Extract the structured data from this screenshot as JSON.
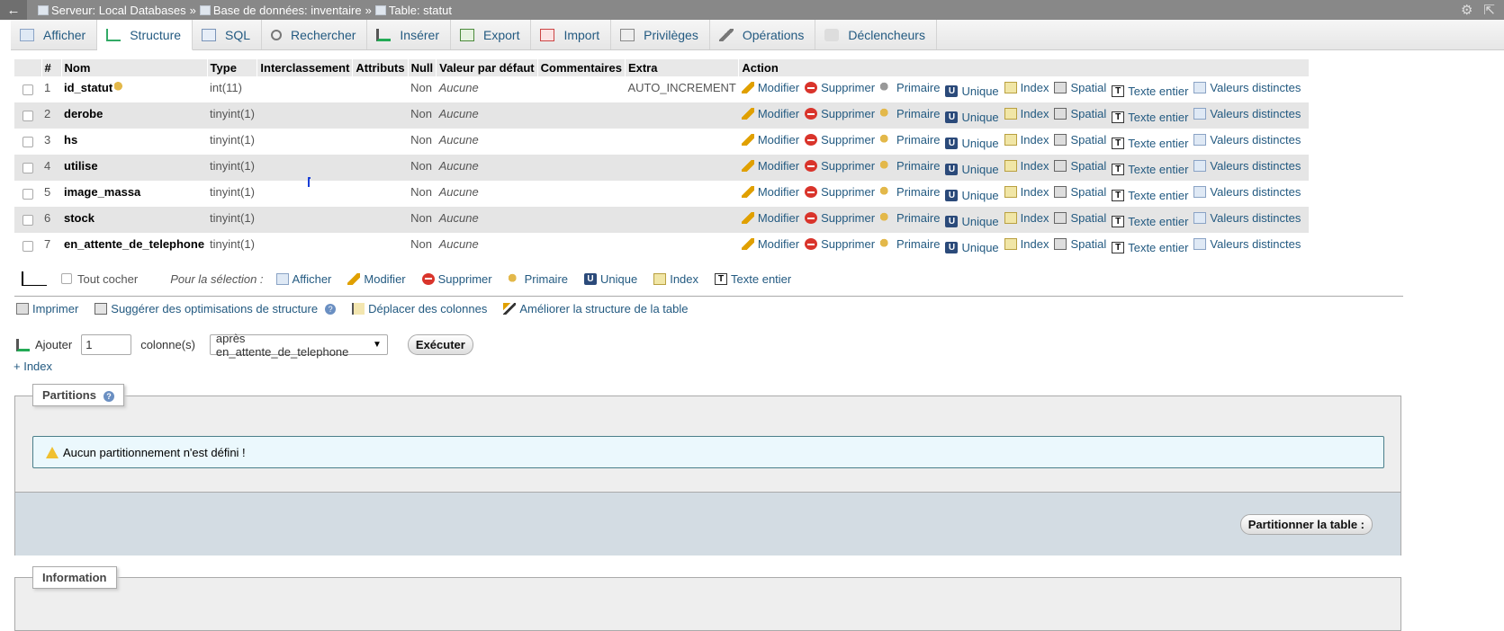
{
  "breadcrumb": {
    "back": "←",
    "server": "Serveur: Local Databases",
    "database": "Base de données: inventaire",
    "table": "Table: statut",
    "separator": "»"
  },
  "tabs": [
    {
      "label": "Afficher",
      "icon": "browse-icon"
    },
    {
      "label": "Structure",
      "icon": "structure-icon",
      "active": true
    },
    {
      "label": "SQL",
      "icon": "sql-icon"
    },
    {
      "label": "Rechercher",
      "icon": "search-icon"
    },
    {
      "label": "Insérer",
      "icon": "insert-icon"
    },
    {
      "label": "Export",
      "icon": "export-icon"
    },
    {
      "label": "Import",
      "icon": "import-icon"
    },
    {
      "label": "Privilèges",
      "icon": "privileges-icon"
    },
    {
      "label": "Opérations",
      "icon": "wrench-icon"
    },
    {
      "label": "Déclencheurs",
      "icon": "triggers-icon"
    }
  ],
  "table": {
    "headers": [
      "#",
      "Nom",
      "Type",
      "Interclassement",
      "Attributs",
      "Null",
      "Valeur par défaut",
      "Commentaires",
      "Extra",
      "Action"
    ],
    "actions": {
      "modifier": "Modifier",
      "supprimer": "Supprimer",
      "primaire": "Primaire",
      "unique": "Unique",
      "index": "Index",
      "spatial": "Spatial",
      "texte": "Texte entier",
      "valeurs": "Valeurs distinctes"
    },
    "rows": [
      {
        "num": "1",
        "name": "id_statut",
        "type": "int(11)",
        "null": "Non",
        "default": "Aucune",
        "extra": "AUTO_INCREMENT",
        "primary": true
      },
      {
        "num": "2",
        "name": "derobe",
        "type": "tinyint(1)",
        "null": "Non",
        "default": "Aucune",
        "extra": ""
      },
      {
        "num": "3",
        "name": "hs",
        "type": "tinyint(1)",
        "null": "Non",
        "default": "Aucune",
        "extra": ""
      },
      {
        "num": "4",
        "name": "utilise",
        "type": "tinyint(1)",
        "null": "Non",
        "default": "Aucune",
        "extra": ""
      },
      {
        "num": "5",
        "name": "image_massa",
        "type": "tinyint(1)",
        "null": "Non",
        "default": "Aucune",
        "extra": ""
      },
      {
        "num": "6",
        "name": "stock",
        "type": "tinyint(1)",
        "null": "Non",
        "default": "Aucune",
        "extra": ""
      },
      {
        "num": "7",
        "name": "en_attente_de_telephone",
        "type": "tinyint(1)",
        "null": "Non",
        "default": "Aucune",
        "extra": ""
      }
    ]
  },
  "selection": {
    "check_all": "Tout cocher",
    "for_selection": "Pour la sélection :",
    "afficher": "Afficher",
    "modifier": "Modifier",
    "supprimer": "Supprimer",
    "primaire": "Primaire",
    "unique": "Unique",
    "index": "Index",
    "texte": "Texte entier"
  },
  "links": {
    "print": "Imprimer",
    "suggest": "Suggérer des optimisations de structure",
    "move": "Déplacer des colonnes",
    "improve": "Améliorer la structure de la table"
  },
  "add": {
    "label": "Ajouter",
    "count": "1",
    "unit": "colonne(s)",
    "position": "après en_attente_de_telephone",
    "execute": "Exécuter",
    "plus_index": "+ Index"
  },
  "partitions": {
    "legend": "Partitions",
    "notice": "Aucun partitionnement n'est défini !",
    "button": "Partitionner la table :"
  },
  "information": {
    "legend": "Information"
  },
  "colors": {
    "link": "#235a81",
    "topbar": "#888888",
    "row_alt": "#e5e5e5",
    "notice_bg": "#ebf8fd"
  }
}
